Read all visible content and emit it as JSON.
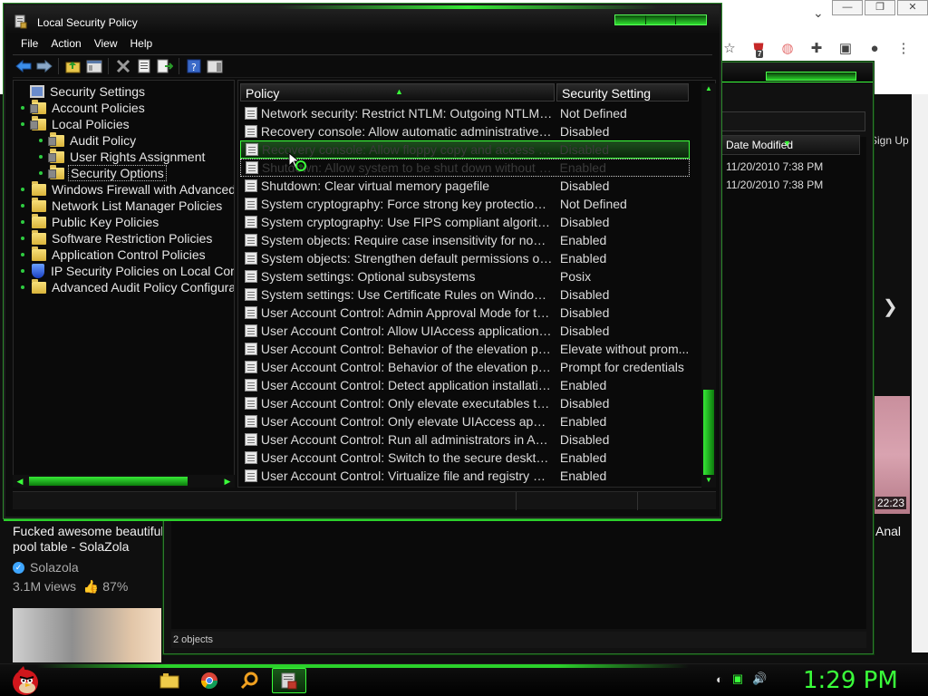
{
  "browser": {
    "date_header": "Date Modified",
    "dates": [
      "11/20/2010 7:38 PM",
      "11/20/2010 7:38 PM"
    ],
    "status_objects": "2 objects",
    "sign_up": "Sign Up",
    "video_title": "Fucked awesome beautiful pool table - SolaZola",
    "channel": "Solazola",
    "views": "3.1M views",
    "rating": "87%",
    "duration": "22:23",
    "right_title": "Anal",
    "extension_badge": "7"
  },
  "window": {
    "title": "Local Security Policy",
    "menu": [
      "File",
      "Action",
      "View",
      "Help"
    ]
  },
  "tree": [
    {
      "label": "Security Settings",
      "level": 0,
      "icon": "monitor-icon"
    },
    {
      "label": "Account Policies",
      "level": 1,
      "icon": "folder-icon"
    },
    {
      "label": "Local Policies",
      "level": 1,
      "icon": "folder-icon"
    },
    {
      "label": "Audit Policy",
      "level": 2,
      "icon": "folder-icon"
    },
    {
      "label": "User Rights Assignment",
      "level": 2,
      "icon": "folder-icon"
    },
    {
      "label": "Security Options",
      "level": 2,
      "icon": "folder-icon",
      "selected": true
    },
    {
      "label": "Windows Firewall with Advanced S",
      "level": 1,
      "icon": "folder-icon"
    },
    {
      "label": "Network List Manager Policies",
      "level": 1,
      "icon": "folder-icon"
    },
    {
      "label": "Public Key Policies",
      "level": 1,
      "icon": "folder-icon"
    },
    {
      "label": "Software Restriction Policies",
      "level": 1,
      "icon": "folder-icon"
    },
    {
      "label": "Application Control Policies",
      "level": 1,
      "icon": "folder-icon"
    },
    {
      "label": "IP Security Policies on Local Com",
      "level": 1,
      "icon": "shield-icon"
    },
    {
      "label": "Advanced Audit Policy Configurati",
      "level": 1,
      "icon": "folder-icon"
    }
  ],
  "list": {
    "columns": [
      "Policy",
      "Security Setting"
    ],
    "rows": [
      {
        "policy": "Network security: Restrict NTLM: Outgoing NTLM traff...",
        "setting": "Not Defined"
      },
      {
        "policy": "Recovery console: Allow automatic administrative logon",
        "setting": "Disabled"
      },
      {
        "policy": "Recovery console: Allow floppy copy and access to al...",
        "setting": "Disabled",
        "state": "sel"
      },
      {
        "policy": "Shutdown: Allow system to be shut down without havi...",
        "setting": "Enabled",
        "state": "focus"
      },
      {
        "policy": "Shutdown: Clear virtual memory pagefile",
        "setting": "Disabled"
      },
      {
        "policy": "System cryptography: Force strong key protection for...",
        "setting": "Not Defined"
      },
      {
        "policy": "System cryptography: Use FIPS compliant algorithms...",
        "setting": "Disabled"
      },
      {
        "policy": "System objects: Require case insensitivity for non-Wi...",
        "setting": "Enabled"
      },
      {
        "policy": "System objects: Strengthen default permissions of int...",
        "setting": "Enabled"
      },
      {
        "policy": "System settings: Optional subsystems",
        "setting": "Posix"
      },
      {
        "policy": "System settings: Use Certificate Rules on Windows ...",
        "setting": "Disabled"
      },
      {
        "policy": "User Account Control: Admin Approval Mode for the B...",
        "setting": "Disabled"
      },
      {
        "policy": "User Account Control: Allow UIAccess applications to...",
        "setting": "Disabled"
      },
      {
        "policy": "User Account Control: Behavior of the elevation promp...",
        "setting": "Elevate without prom..."
      },
      {
        "policy": "User Account Control: Behavior of the elevation promp...",
        "setting": "Prompt for credentials"
      },
      {
        "policy": "User Account Control: Detect application installations ...",
        "setting": "Enabled"
      },
      {
        "policy": "User Account Control: Only elevate executables that ...",
        "setting": "Disabled"
      },
      {
        "policy": "User Account Control: Only elevate UIAccess applicat...",
        "setting": "Enabled"
      },
      {
        "policy": "User Account Control: Run all administrators in Admin...",
        "setting": "Disabled"
      },
      {
        "policy": "User Account Control: Switch to the secure desktop ...",
        "setting": "Enabled"
      },
      {
        "policy": "User Account Control: Virtualize file and registry write ...",
        "setting": "Enabled"
      }
    ]
  },
  "taskbar": {
    "clock": "1:29 PM"
  },
  "colors": {
    "accent": "#2bd12b",
    "text": "#dcdcdc"
  }
}
